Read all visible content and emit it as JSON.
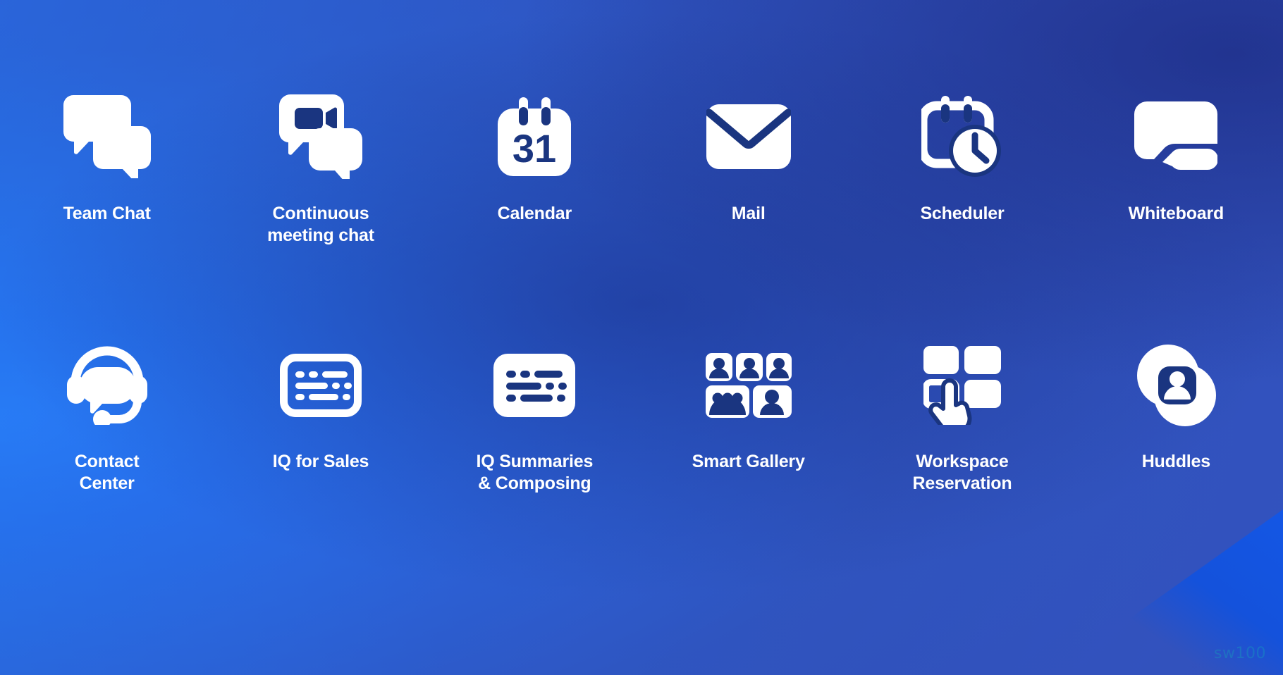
{
  "page": {
    "background_color_left": "#1553e2",
    "background_color_center": "#1a2a80",
    "background_color_topleft": "#123ba6",
    "icon_color": "#ffffff",
    "label_color": "#ffffff",
    "watermark": "sw100"
  },
  "features": [
    {
      "id": "team-chat",
      "label": "Team Chat",
      "icon": "two-chat-bubbles-icon",
      "row": 1
    },
    {
      "id": "continuous-meeting-chat",
      "label": "Continuous\nmeeting chat",
      "icon": "video-chat-bubbles-icon",
      "row": 1
    },
    {
      "id": "calendar",
      "label": "Calendar",
      "icon": "calendar-31-icon",
      "row": 1
    },
    {
      "id": "mail",
      "label": "Mail",
      "icon": "envelope-icon",
      "row": 1
    },
    {
      "id": "scheduler",
      "label": "Scheduler",
      "icon": "calendar-clock-icon",
      "row": 1
    },
    {
      "id": "whiteboard",
      "label": "Whiteboard",
      "icon": "whiteboard-pen-icon",
      "row": 1
    },
    {
      "id": "contact-center",
      "label": "Contact\nCenter",
      "icon": "headset-chat-bubble-icon",
      "row": 2
    },
    {
      "id": "iq-for-sales",
      "label": "IQ for Sales",
      "icon": "transcript-outline-icon",
      "row": 2
    },
    {
      "id": "iq-summaries-composing",
      "label": "IQ Summaries\n& Composing",
      "icon": "transcript-filled-icon",
      "row": 2
    },
    {
      "id": "smart-gallery",
      "label": "Smart Gallery",
      "icon": "participant-tiles-icon",
      "row": 2
    },
    {
      "id": "workspace-reservation",
      "label": "Workspace\nReservation",
      "icon": "desk-grid-hand-tap-icon",
      "row": 2
    },
    {
      "id": "huddles",
      "label": "Huddles",
      "icon": "overlapping-circles-avatar-icon",
      "row": 2
    }
  ],
  "calendar": {
    "day_number": "31"
  }
}
